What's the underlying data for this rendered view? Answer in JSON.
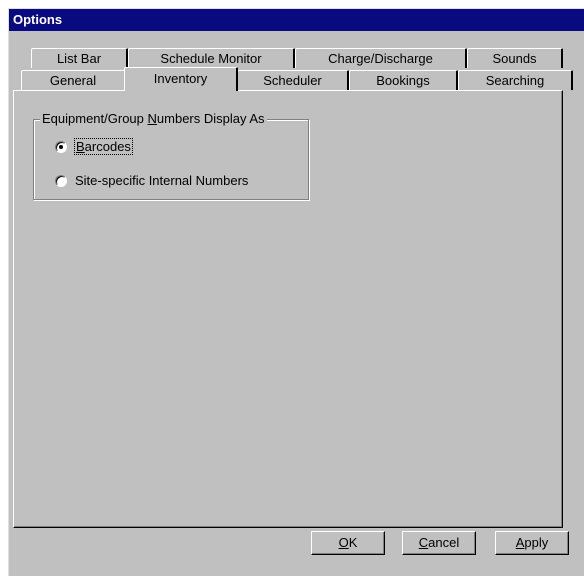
{
  "window": {
    "title": "Options"
  },
  "tabs": {
    "back_row": [
      {
        "label": "List Bar"
      },
      {
        "label": "Schedule Monitor"
      },
      {
        "label": "Charge/Discharge"
      },
      {
        "label": "Sounds"
      }
    ],
    "front_row": [
      {
        "label": "General",
        "active": false
      },
      {
        "label": "Inventory",
        "active": true
      },
      {
        "label": "Scheduler",
        "active": false
      },
      {
        "label": "Bookings",
        "active": false
      },
      {
        "label": "Searching",
        "active": false
      }
    ]
  },
  "group": {
    "label_prefix": "Equipment/Group ",
    "label_mnemonic": "N",
    "label_suffix": "umbers Display As",
    "options": [
      {
        "mnemonic": "B",
        "rest": "arcodes",
        "selected": true
      },
      {
        "mnemonic": "",
        "rest": "Site-specific Internal Numbers",
        "selected": false
      }
    ]
  },
  "buttons": {
    "ok": {
      "mnemonic": "O",
      "rest": "K"
    },
    "cancel": {
      "mnemonic": "C",
      "rest": "ancel"
    },
    "apply": {
      "mnemonic": "A",
      "rest": "pply"
    }
  },
  "colors": {
    "title_bar": "#0a0a80",
    "face": "#c0c0c0"
  }
}
